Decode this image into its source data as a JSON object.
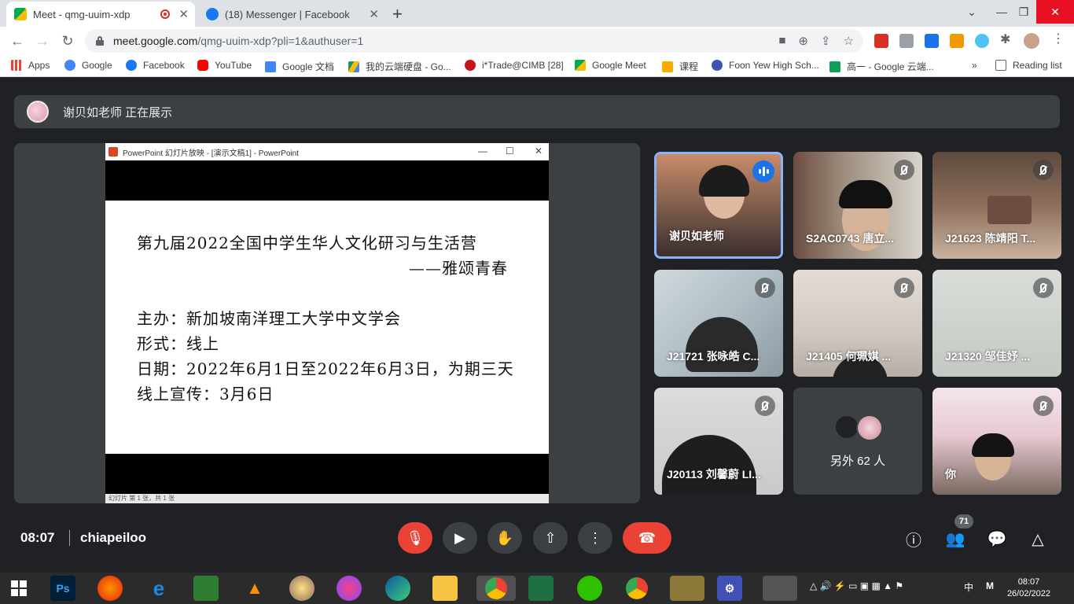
{
  "browser": {
    "tabs": [
      {
        "title": "Meet - qmg-uuim-xdp",
        "active": true
      },
      {
        "title": "(18) Messenger | Facebook",
        "active": false
      }
    ],
    "url_host": "meet.google.com",
    "url_path": "/qmg-uuim-xdp?pli=1&authuser=1",
    "bookmarks": [
      {
        "label": "Apps"
      },
      {
        "label": "Google"
      },
      {
        "label": "Facebook"
      },
      {
        "label": "YouTube"
      },
      {
        "label": "Google 文档"
      },
      {
        "label": "我的云端硬盘 - Go..."
      },
      {
        "label": "i*Trade@CIMB [28]"
      },
      {
        "label": "Google Meet"
      },
      {
        "label": "课程"
      },
      {
        "label": "Foon Yew High Sch..."
      },
      {
        "label": "高一 - Google 云端..."
      }
    ],
    "bookmarks_more": "»",
    "reading_list": "Reading list"
  },
  "meet": {
    "presenting_text": "谢贝如老师 正在展示",
    "ppt_window_title": "PowerPoint 幻灯片放映 - [演示文稿1] - PowerPoint",
    "ppt_status": "幻灯片 第 1 张，共 1 张",
    "slide_lines": [
      "第九届2022全国中学生华人文化研习与生活营",
      "——雅颂青春",
      "主办：新加坡南洋理工大学中文学会",
      "形式：线上",
      "日期：2022年6月1日至2022年6月3日，为期三天",
      "线上宣传：3月6日"
    ],
    "participants": [
      {
        "name": "谢贝如老师",
        "speaking": true
      },
      {
        "name": "S2AC0743 唐立...",
        "speaking": false
      },
      {
        "name": "J21623 陈靖阳 T...",
        "speaking": false
      },
      {
        "name": "J21721 张咏皓 C...",
        "speaking": false
      },
      {
        "name": "J21405 何珮娸 ...",
        "speaking": false
      },
      {
        "name": "J21320 邹佳妤 ...",
        "speaking": false
      },
      {
        "name": "J20113 刘馨蔚 LI...",
        "speaking": false
      },
      {
        "name": "你",
        "speaking": false
      }
    ],
    "others_label": "另外 62 人",
    "time": "08:07",
    "meeting_code": "chiapeiloo",
    "people_count": "71"
  },
  "taskbar": {
    "ime": "中",
    "ime_mode": "M",
    "clock_time": "08:07",
    "clock_date": "26/02/2022",
    "apps": [
      {
        "label": "Ps",
        "color": "#001e36"
      }
    ]
  },
  "colors": {
    "meet_bg": "#202124",
    "end_call": "#ea4335",
    "speaking_border": "#8ab4f8"
  }
}
